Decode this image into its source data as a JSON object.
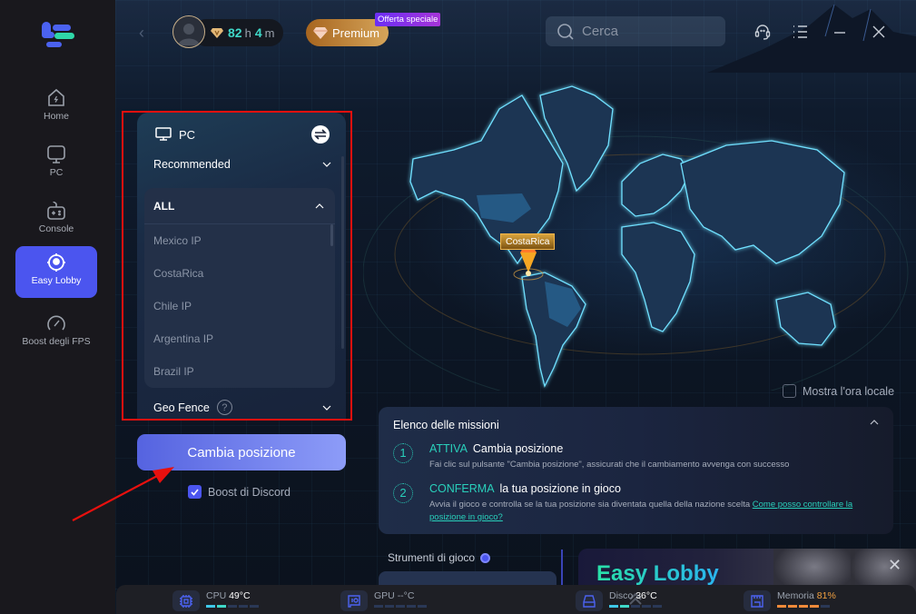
{
  "app": {
    "logo": "logo-icon"
  },
  "sidebar": {
    "items": [
      {
        "label": "Home",
        "icon": "home-icon",
        "active": false
      },
      {
        "label": "PC",
        "icon": "monitor-icon",
        "active": false
      },
      {
        "label": "Console",
        "icon": "gamepad-icon",
        "active": false
      },
      {
        "label": "Easy Lobby",
        "icon": "location-target-icon",
        "active": true
      },
      {
        "label": "Boost degli FPS",
        "icon": "speedometer-icon",
        "active": false
      }
    ]
  },
  "topbar": {
    "time_hours": "82",
    "time_hours_unit": "h",
    "time_minutes": "4",
    "time_minutes_unit": "m",
    "premium_label": "Premium",
    "offer_badge": "Offerta speciale",
    "search_placeholder": "Cerca",
    "icons": [
      "back-icon",
      "support-headset-icon",
      "menu-list-icon",
      "minimize-icon",
      "close-icon"
    ]
  },
  "panel": {
    "platform": "PC",
    "recommended_label": "Recommended",
    "group_label": "ALL",
    "regions": [
      "Mexico IP",
      "CostaRica",
      "Chile IP",
      "Argentina IP",
      "Brazil IP"
    ],
    "geo_fence_label": "Geo Fence",
    "help_glyph": "?",
    "change_button": "Cambia posizione",
    "discord_boost_label": "Boost di Discord",
    "discord_boost_checked": true
  },
  "map": {
    "selected_location": "CostaRica",
    "show_local_time_label": "Mostra l'ora locale",
    "show_local_time_checked": false
  },
  "missions": {
    "title": "Elenco delle missioni",
    "steps": [
      {
        "num": "1",
        "keyword": "ATTIVA",
        "title": "Cambia posizione",
        "desc": "Fai clic sul pulsante \"Cambia posizione\", assicurati che il cambiamento avvenga con successo",
        "link": ""
      },
      {
        "num": "2",
        "keyword": "CONFERMA",
        "title": "la tua posizione in gioco",
        "desc": "Avvia il gioco e controlla se la tua posizione sia diventata quella della nazione scelta ",
        "link": "Come posso controllare la posizione in gioco?"
      }
    ]
  },
  "tools": {
    "title": "Strumenti di gioco"
  },
  "banner": {
    "title": "Easy Lobby"
  },
  "status": {
    "cpu": {
      "label": "CPU",
      "value": "49°C",
      "level": 2,
      "of": 5
    },
    "gpu": {
      "label": "GPU",
      "value": "--°C",
      "level": 0,
      "of": 5
    },
    "disk": {
      "label": "Disco",
      "value": "36°C",
      "level": 2,
      "of": 5
    },
    "memory": {
      "label": "Memoria",
      "value": "81%",
      "level": 4,
      "of": 5
    },
    "colors": {
      "cool": "#3fc8e8",
      "teal": "#3fd8c8",
      "warm": "#f08a3a",
      "empty": "#2a3856",
      "memory_text": "#f0a040"
    }
  }
}
